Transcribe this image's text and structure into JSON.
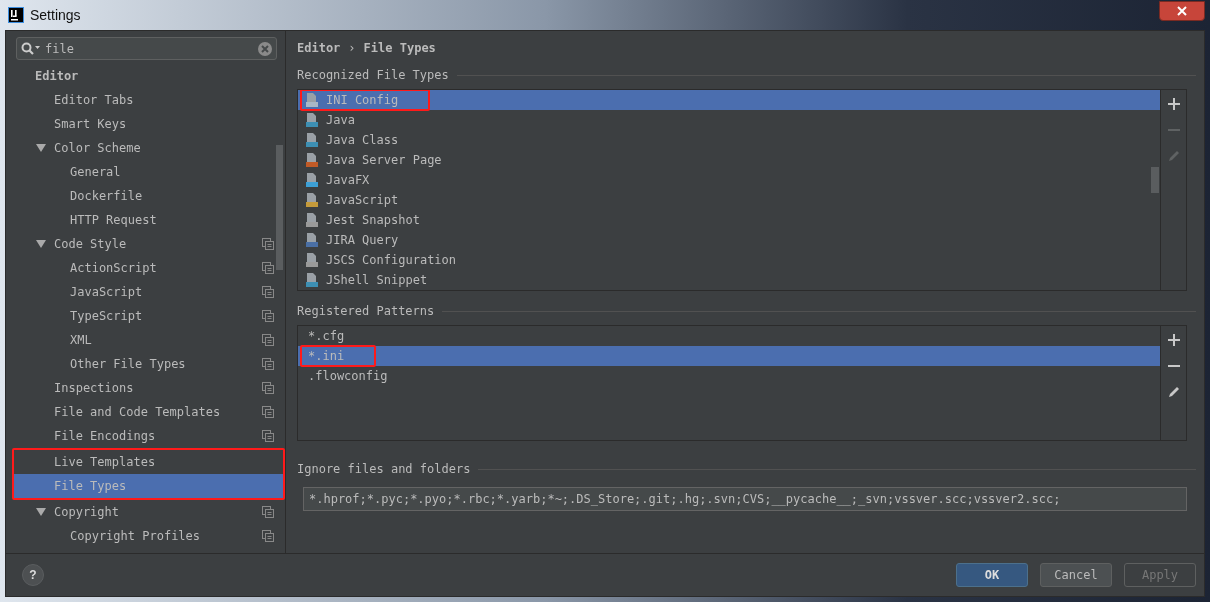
{
  "window": {
    "title": "Settings"
  },
  "search": {
    "value": "file"
  },
  "tree": [
    {
      "label": "Editor",
      "bold": true,
      "project_level": false,
      "selected": false,
      "annotated": false,
      "children": [
        {
          "label": "Editor Tabs",
          "project_level": false,
          "selected": false,
          "annotated": false
        },
        {
          "label": "Smart Keys",
          "project_level": false,
          "selected": false,
          "annotated": false
        },
        {
          "label": "Color Scheme",
          "project_level": false,
          "selected": false,
          "annotated": false,
          "expanded": true,
          "children": [
            {
              "label": "General",
              "project_level": false,
              "selected": false,
              "annotated": false
            },
            {
              "label": "Dockerfile",
              "project_level": false,
              "selected": false,
              "annotated": false
            },
            {
              "label": "HTTP Request",
              "project_level": false,
              "selected": false,
              "annotated": false
            }
          ]
        },
        {
          "label": "Code Style",
          "project_level": true,
          "selected": false,
          "annotated": false,
          "expanded": true,
          "children": [
            {
              "label": "ActionScript",
              "project_level": true,
              "selected": false,
              "annotated": false
            },
            {
              "label": "JavaScript",
              "project_level": true,
              "selected": false,
              "annotated": false
            },
            {
              "label": "TypeScript",
              "project_level": true,
              "selected": false,
              "annotated": false
            },
            {
              "label": "XML",
              "project_level": true,
              "selected": false,
              "annotated": false
            },
            {
              "label": "Other File Types",
              "project_level": true,
              "selected": false,
              "annotated": false
            }
          ]
        },
        {
          "label": "Inspections",
          "project_level": true,
          "selected": false,
          "annotated": false
        },
        {
          "label": "File and Code Templates",
          "project_level": true,
          "selected": false,
          "annotated": false
        },
        {
          "label": "File Encodings",
          "project_level": true,
          "selected": false,
          "annotated": false
        },
        {
          "label": "Live Templates",
          "project_level": false,
          "selected": false,
          "annotated": true
        },
        {
          "label": "File Types",
          "project_level": false,
          "selected": true,
          "annotated": true
        },
        {
          "label": "Copyright",
          "project_level": true,
          "selected": false,
          "annotated": false,
          "expanded": true,
          "children": [
            {
              "label": "Copyright Profiles",
              "project_level": true,
              "selected": false,
              "annotated": false
            }
          ]
        }
      ]
    }
  ],
  "breadcrumb": [
    "Editor",
    "›",
    "File Types"
  ],
  "recognized": {
    "heading": "Recognized File Types",
    "items": [
      {
        "label": "INI Config",
        "color": "#a9b7c6",
        "selected": true,
        "annotated": true
      },
      {
        "label": "Java",
        "color": "#3d8fb3",
        "selected": false,
        "annotated": false
      },
      {
        "label": "Java Class",
        "color": "#3d8fb3",
        "selected": false,
        "annotated": false
      },
      {
        "label": "Java Server Page",
        "color": "#c05a27",
        "selected": false,
        "annotated": false
      },
      {
        "label": "JavaFX",
        "color": "#3da0d6",
        "selected": false,
        "annotated": false
      },
      {
        "label": "JavaScript",
        "color": "#c49a3b",
        "selected": false,
        "annotated": false
      },
      {
        "label": "Jest Snapshot",
        "color": "#9a9a9a",
        "selected": false,
        "annotated": false
      },
      {
        "label": "JIRA Query",
        "color": "#4a6fa5",
        "selected": false,
        "annotated": false
      },
      {
        "label": "JSCS Configuration",
        "color": "#9a9a9a",
        "selected": false,
        "annotated": false
      },
      {
        "label": "JShell Snippet",
        "color": "#3d8fb3",
        "selected": false,
        "annotated": false
      }
    ],
    "tools": [
      {
        "kind": "add",
        "disabled": false
      },
      {
        "kind": "remove",
        "disabled": true
      },
      {
        "kind": "edit",
        "disabled": true
      }
    ]
  },
  "patterns": {
    "heading": "Registered Patterns",
    "items": [
      {
        "label": "*.cfg",
        "selected": false,
        "annotated": false
      },
      {
        "label": "*.ini",
        "selected": true,
        "annotated": true
      },
      {
        "label": ".flowconfig",
        "selected": false,
        "annotated": false
      }
    ],
    "tools": [
      {
        "kind": "add",
        "disabled": false
      },
      {
        "kind": "remove",
        "disabled": false
      },
      {
        "kind": "edit",
        "disabled": false
      }
    ]
  },
  "ignore": {
    "heading": "Ignore files and folders",
    "value": "*.hprof;*.pyc;*.pyo;*.rbc;*.yarb;*~;.DS_Store;.git;.hg;.svn;CVS;__pycache__;_svn;vssver.scc;vssver2.scc;"
  },
  "help": {
    "label": "?"
  },
  "buttons": [
    {
      "label": "OK",
      "kind": "primary",
      "disabled": false
    },
    {
      "label": "Cancel",
      "kind": "secondary",
      "disabled": false
    },
    {
      "label": "Apply",
      "kind": "secondary",
      "disabled": true
    }
  ]
}
